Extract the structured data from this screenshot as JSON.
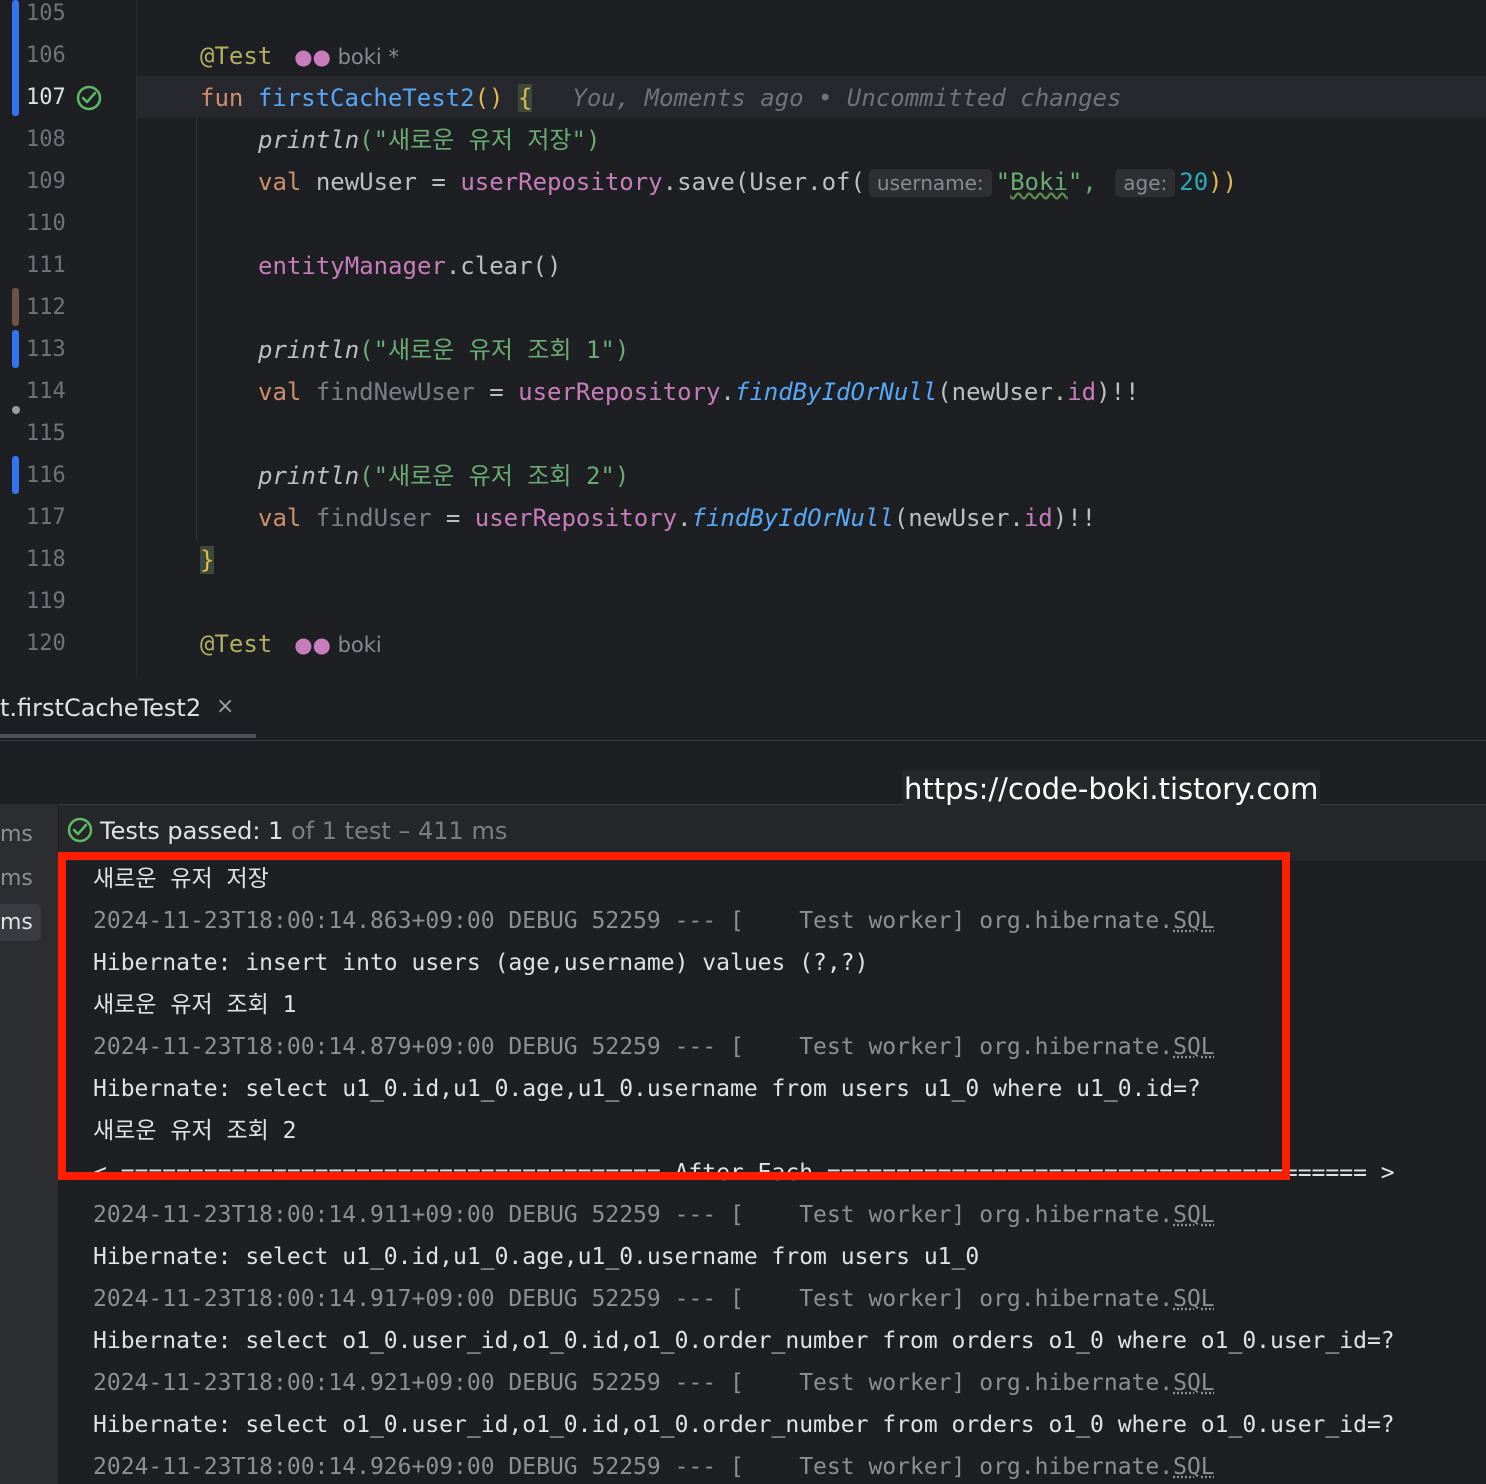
{
  "editor": {
    "line_numbers": [
      "105",
      "106",
      "107",
      "108",
      "109",
      "110",
      "111",
      "112",
      "113",
      "114",
      "115",
      "116",
      "117",
      "118",
      "119",
      "120"
    ],
    "current_line": "107",
    "annotation": "@Test",
    "author_1": "boki",
    "author_1_mark": "*",
    "author_2": "boki",
    "fun_keyword": "fun",
    "fun_name": "firstCacheTest2",
    "fun_parens": "()",
    "open_brace": "{",
    "blame": "You, Moments ago • Uncommitted changes",
    "println_fn": "println",
    "l108_str": "(\"새로운 유저 저장\")",
    "val_kw": "val",
    "l109_var": "newUser",
    "eq": " = ",
    "repo": "userRepository",
    "save_call": ".save(User.of(",
    "hint_username": "username:",
    "boki_str_open": "\"",
    "boki_word": "Boki",
    "boki_str_close": "\",",
    "hint_age": "age:",
    "age_value": "20",
    "close_2": "))",
    "em": "entityManager",
    "clear_call": ".clear()",
    "l113_str": "(\"새로운 유저 조회 1\")",
    "l114_var": "findNewUser",
    "dot": ".",
    "find_fn": "findByIdOrNull",
    "find_arg": "(newUser.",
    "id_prop": "id",
    "find_end": ")!!",
    "l116_str": "(\"새로운 유저 조회 2\")",
    "l117_var": "findUser",
    "close_brace": "}"
  },
  "tool_window": {
    "tab_title": "t.firstCacheTest2",
    "tab_close": "×",
    "left_items": [
      "ms",
      "ms",
      "ms"
    ],
    "tests_passed_label": "Tests passed:",
    "tests_passed_count": "1",
    "tests_passed_rest": "of 1 test – 411 ms",
    "watermark": "https://code-boki.tistory.com"
  },
  "console": {
    "lines": [
      {
        "type": "out",
        "text": "새로운 유저 저장"
      },
      {
        "type": "dbg",
        "text": "2024-11-23T18:00:14.863+09:00 DEBUG 52259 --- [    Test worker] org.hibernate.",
        "sql": "SQL"
      },
      {
        "type": "out",
        "text": "Hibernate: insert into users (age,username) values (?,?)"
      },
      {
        "type": "out",
        "text": "새로운 유저 조회 1"
      },
      {
        "type": "dbg",
        "text": "2024-11-23T18:00:14.879+09:00 DEBUG 52259 --- [    Test worker] org.hibernate.",
        "sql": "SQL"
      },
      {
        "type": "out",
        "text": "Hibernate: select u1_0.id,u1_0.age,u1_0.username from users u1_0 where u1_0.id=?"
      },
      {
        "type": "out",
        "text": "새로운 유저 조회 2"
      },
      {
        "type": "out",
        "text": "< ======================================= After Each ======================================= >"
      },
      {
        "type": "dbg",
        "text": "2024-11-23T18:00:14.911+09:00 DEBUG 52259 --- [    Test worker] org.hibernate.",
        "sql": "SQL"
      },
      {
        "type": "out",
        "text": "Hibernate: select u1_0.id,u1_0.age,u1_0.username from users u1_0"
      },
      {
        "type": "dbg",
        "text": "2024-11-23T18:00:14.917+09:00 DEBUG 52259 --- [    Test worker] org.hibernate.",
        "sql": "SQL"
      },
      {
        "type": "out",
        "text": "Hibernate: select o1_0.user_id,o1_0.id,o1_0.order_number from orders o1_0 where o1_0.user_id=?"
      },
      {
        "type": "dbg",
        "text": "2024-11-23T18:00:14.921+09:00 DEBUG 52259 --- [    Test worker] org.hibernate.",
        "sql": "SQL"
      },
      {
        "type": "out",
        "text": "Hibernate: select o1_0.user_id,o1_0.id,o1_0.order_number from orders o1_0 where o1_0.user_id=?"
      },
      {
        "type": "dbg",
        "text": "2024-11-23T18:00:14.926+09:00 DEBUG 52259 --- [    Test worker] org.hibernate.",
        "sql": "SQL"
      }
    ]
  },
  "colors": {
    "highlight_box": "#ff1e00",
    "pass_green": "#5fb865",
    "vcs_modified": "#3574f0"
  }
}
